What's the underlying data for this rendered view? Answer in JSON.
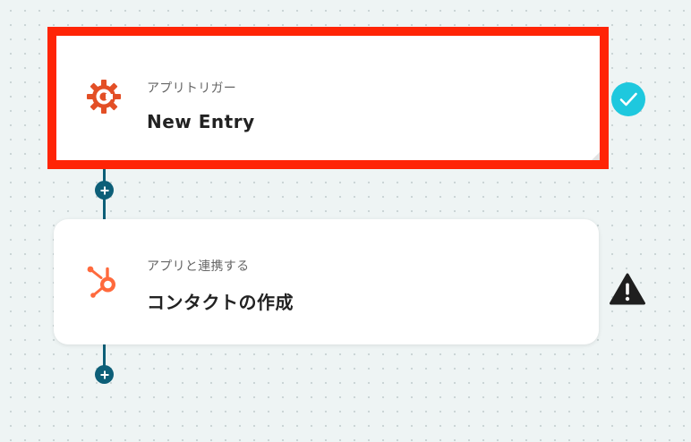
{
  "colors": {
    "highlight_border": "#ff2406",
    "connector": "#0d5f78",
    "success_badge": "#1ec8de",
    "warning_badge": "#1f1f1f",
    "trigger_icon": "#e34f26",
    "hubspot_icon": "#ff6a3d"
  },
  "steps": [
    {
      "subtitle": "アプリトリガー",
      "title": "New Entry",
      "icon": "cognito-forms-gear-icon",
      "status": "success-check-icon",
      "highlighted": true
    },
    {
      "subtitle": "アプリと連携する",
      "title": "コンタクトの作成",
      "icon": "hubspot-sprocket-icon",
      "status": "warning-icon",
      "highlighted": false
    }
  ],
  "add_step_icon": "plus-icon"
}
